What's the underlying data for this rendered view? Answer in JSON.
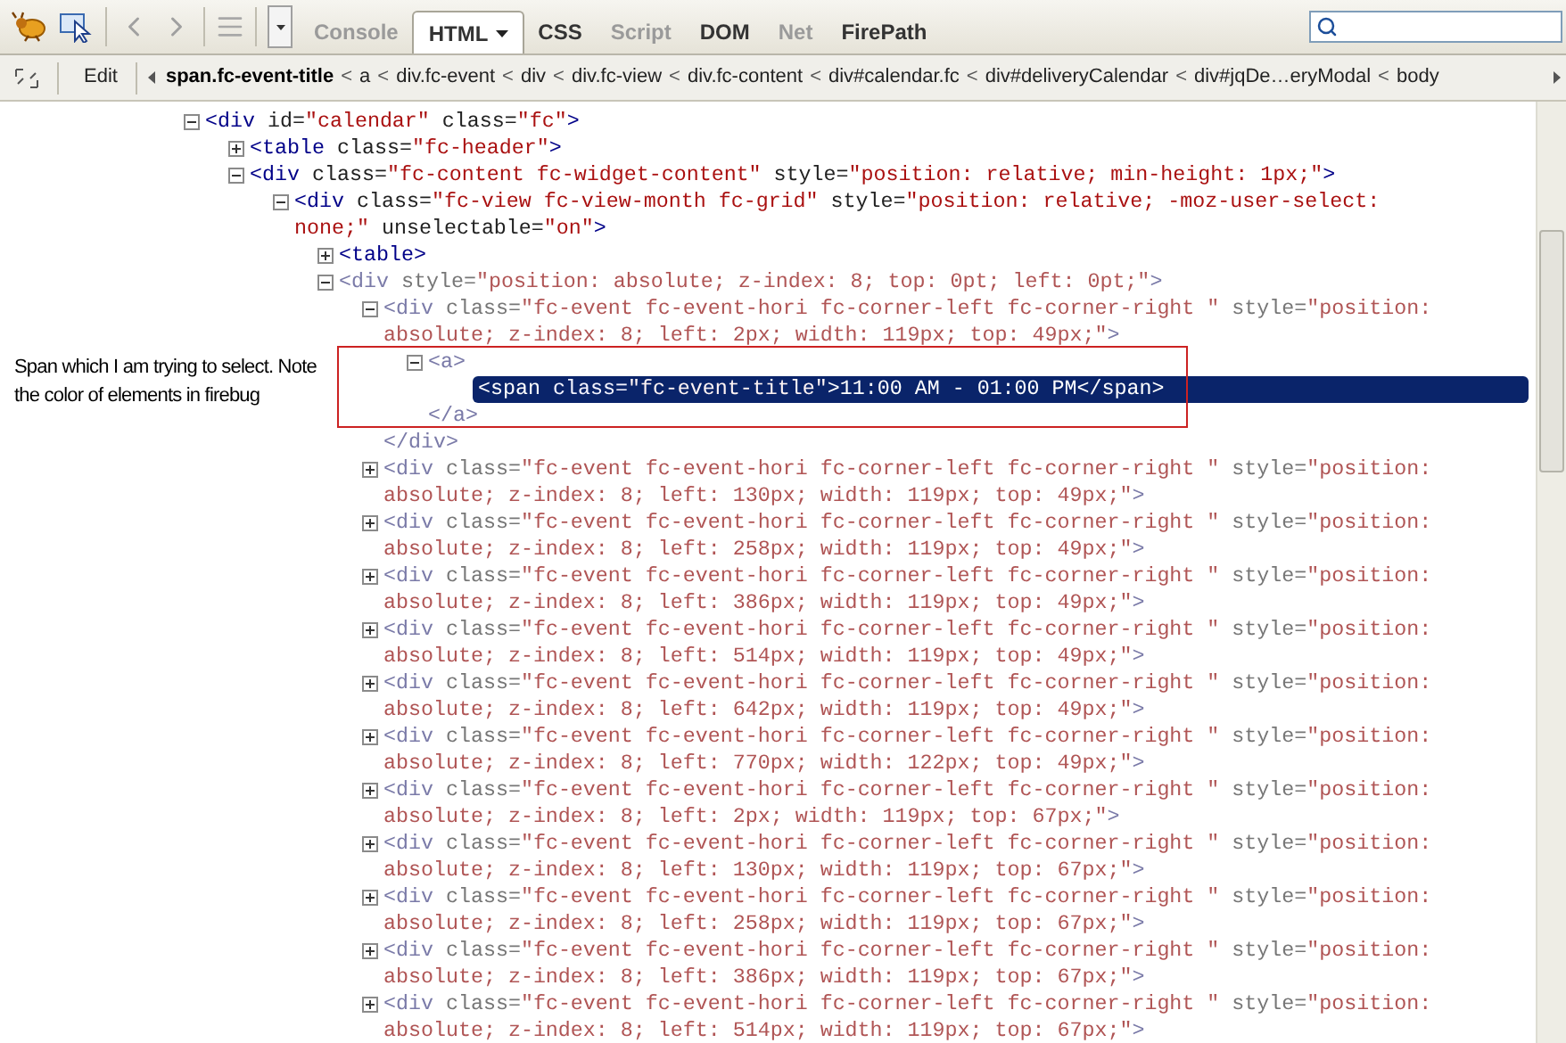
{
  "toolbar": {
    "tabs": [
      {
        "label": "Console",
        "selected": false,
        "disabled": true,
        "menu": false
      },
      {
        "label": "HTML",
        "selected": true,
        "disabled": false,
        "menu": true
      },
      {
        "label": "CSS",
        "selected": false,
        "disabled": false,
        "menu": false
      },
      {
        "label": "Script",
        "selected": false,
        "disabled": true,
        "menu": false
      },
      {
        "label": "DOM",
        "selected": false,
        "disabled": false,
        "menu": false
      },
      {
        "label": "Net",
        "selected": false,
        "disabled": true,
        "menu": false
      },
      {
        "label": "FirePath",
        "selected": false,
        "disabled": false,
        "menu": false
      }
    ]
  },
  "breadcrumb": {
    "edit_button": "Edit",
    "items": [
      {
        "kind": "crumb",
        "label": "span.fc-event-title",
        "selected": true
      },
      {
        "kind": "separator",
        "label": "<"
      },
      {
        "kind": "crumb",
        "label": "a",
        "selected": false
      },
      {
        "kind": "separator",
        "label": "<"
      },
      {
        "kind": "crumb",
        "label": "div.fc-event",
        "selected": false
      },
      {
        "kind": "separator",
        "label": "<"
      },
      {
        "kind": "crumb",
        "label": "div",
        "selected": false
      },
      {
        "kind": "separator",
        "label": "<"
      },
      {
        "kind": "crumb",
        "label": "div.fc-view",
        "selected": false
      },
      {
        "kind": "separator",
        "label": "<"
      },
      {
        "kind": "crumb",
        "label": "div.fc-content",
        "selected": false
      },
      {
        "kind": "separator",
        "label": "<"
      },
      {
        "kind": "crumb",
        "label": "div#calendar.fc",
        "selected": false
      },
      {
        "kind": "separator",
        "label": "<"
      },
      {
        "kind": "crumb",
        "label": "div#deliveryCalendar",
        "selected": false
      },
      {
        "kind": "separator",
        "label": "<"
      },
      {
        "kind": "crumb",
        "label": "div#jqDe…eryModal",
        "selected": false
      },
      {
        "kind": "separator",
        "label": "<"
      },
      {
        "kind": "crumb",
        "label": "body",
        "selected": false
      }
    ]
  },
  "tree": [
    {
      "expanded": true,
      "faded": false,
      "selected": false,
      "parts": [
        {
          "kind": "tag",
          "text": "<div"
        },
        {
          "kind": "attr",
          "text": " id="
        },
        {
          "kind": "value",
          "text": "\"calendar\""
        },
        {
          "kind": "attr",
          "text": " class="
        },
        {
          "kind": "value",
          "text": "\"fc\""
        },
        {
          "kind": "tag",
          "text": ">"
        }
      ],
      "children": [
        {
          "expanded": false,
          "faded": false,
          "selected": false,
          "parts": [
            {
              "kind": "tag",
              "text": "<table"
            },
            {
              "kind": "attr",
              "text": " class="
            },
            {
              "kind": "value",
              "text": "\"fc-header\""
            },
            {
              "kind": "tag",
              "text": ">"
            }
          ]
        },
        {
          "expanded": true,
          "faded": false,
          "selected": false,
          "parts": [
            {
              "kind": "tag",
              "text": "<div"
            },
            {
              "kind": "attr",
              "text": " class="
            },
            {
              "kind": "value",
              "text": "\"fc-content fc-widget-content\""
            },
            {
              "kind": "attr",
              "text": " style="
            },
            {
              "kind": "value",
              "text": "\"position: relative; min-height: 1px;\""
            },
            {
              "kind": "tag",
              "text": ">"
            }
          ],
          "children": [
            {
              "expanded": true,
              "faded": false,
              "selected": false,
              "parts": [
                {
                  "kind": "tag",
                  "text": "<div"
                },
                {
                  "kind": "attr",
                  "text": " class="
                },
                {
                  "kind": "value",
                  "text": "\"fc-view fc-view-month fc-grid\""
                },
                {
                  "kind": "attr",
                  "text": " style="
                },
                {
                  "kind": "value",
                  "text": "\"position: relative; -moz-user-select: none;\""
                },
                {
                  "kind": "attr",
                  "text": " unselectable="
                },
                {
                  "kind": "value",
                  "text": "\"on\""
                },
                {
                  "kind": "tag",
                  "text": ">"
                }
              ],
              "children": [
                {
                  "expanded": false,
                  "faded": false,
                  "selected": false,
                  "parts": [
                    {
                      "kind": "tag",
                      "text": "<table"
                    },
                    {
                      "kind": "tag",
                      "text": ">"
                    }
                  ]
                },
                {
                  "expanded": true,
                  "faded": true,
                  "selected": false,
                  "parts": [
                    {
                      "kind": "tag",
                      "text": "<div"
                    },
                    {
                      "kind": "attr",
                      "text": " style="
                    },
                    {
                      "kind": "value",
                      "text": "\"position: absolute; z-index: 8; top: 0pt; left: 0pt;\""
                    },
                    {
                      "kind": "tag",
                      "text": ">"
                    }
                  ],
                  "children": [
                    {
                      "expanded": true,
                      "faded": true,
                      "selected": false,
                      "parts": [
                        {
                          "kind": "tag",
                          "text": "<div"
                        },
                        {
                          "kind": "attr",
                          "text": " class="
                        },
                        {
                          "kind": "value",
                          "text": "\"fc-event fc-event-hori fc-corner-left fc-corner-right \""
                        },
                        {
                          "kind": "attr",
                          "text": " style="
                        },
                        {
                          "kind": "value",
                          "text": "\"position: absolute; z-index: 8; left: 2px; width: 119px; top: 49px;\""
                        },
                        {
                          "kind": "tag",
                          "text": ">"
                        }
                      ],
                      "closing": "</div>",
                      "children": [
                        {
                          "expanded": true,
                          "faded": true,
                          "selected": false,
                          "parts": [
                            {
                              "kind": "tag",
                              "text": "<a"
                            },
                            {
                              "kind": "tag",
                              "text": ">"
                            }
                          ],
                          "closing": "</a>",
                          "children": [
                            {
                              "selected": true,
                              "parts": [
                                {
                                  "kind": "tag",
                                  "text": "<span"
                                },
                                {
                                  "kind": "attr",
                                  "text": " class="
                                },
                                {
                                  "kind": "value",
                                  "text": "\"fc-event-title\""
                                },
                                {
                                  "kind": "tag",
                                  "text": ">"
                                },
                                {
                                  "kind": "text",
                                  "text": "11:00 AM - 01:00 PM"
                                },
                                {
                                  "kind": "tag",
                                  "text": "</span>"
                                }
                              ]
                            }
                          ]
                        }
                      ]
                    },
                    {
                      "expanded": false,
                      "faded": true,
                      "selected": false,
                      "parts": [
                        {
                          "kind": "tag",
                          "text": "<div"
                        },
                        {
                          "kind": "attr",
                          "text": " class="
                        },
                        {
                          "kind": "value",
                          "text": "\"fc-event fc-event-hori fc-corner-left fc-corner-right \""
                        },
                        {
                          "kind": "attr",
                          "text": " style="
                        },
                        {
                          "kind": "value",
                          "text": "\"position: absolute; z-index: 8; left: 130px; width: 119px; top: 49px;\""
                        },
                        {
                          "kind": "tag",
                          "text": ">"
                        }
                      ]
                    },
                    {
                      "expanded": false,
                      "faded": true,
                      "selected": false,
                      "parts": [
                        {
                          "kind": "tag",
                          "text": "<div"
                        },
                        {
                          "kind": "attr",
                          "text": " class="
                        },
                        {
                          "kind": "value",
                          "text": "\"fc-event fc-event-hori fc-corner-left fc-corner-right \""
                        },
                        {
                          "kind": "attr",
                          "text": " style="
                        },
                        {
                          "kind": "value",
                          "text": "\"position: absolute; z-index: 8; left: 258px; width: 119px; top: 49px;\""
                        },
                        {
                          "kind": "tag",
                          "text": ">"
                        }
                      ]
                    },
                    {
                      "expanded": false,
                      "faded": true,
                      "selected": false,
                      "parts": [
                        {
                          "kind": "tag",
                          "text": "<div"
                        },
                        {
                          "kind": "attr",
                          "text": " class="
                        },
                        {
                          "kind": "value",
                          "text": "\"fc-event fc-event-hori fc-corner-left fc-corner-right \""
                        },
                        {
                          "kind": "attr",
                          "text": " style="
                        },
                        {
                          "kind": "value",
                          "text": "\"position: absolute; z-index: 8; left: 386px; width: 119px; top: 49px;\""
                        },
                        {
                          "kind": "tag",
                          "text": ">"
                        }
                      ]
                    },
                    {
                      "expanded": false,
                      "faded": true,
                      "selected": false,
                      "parts": [
                        {
                          "kind": "tag",
                          "text": "<div"
                        },
                        {
                          "kind": "attr",
                          "text": " class="
                        },
                        {
                          "kind": "value",
                          "text": "\"fc-event fc-event-hori fc-corner-left fc-corner-right \""
                        },
                        {
                          "kind": "attr",
                          "text": " style="
                        },
                        {
                          "kind": "value",
                          "text": "\"position: absolute; z-index: 8; left: 514px; width: 119px; top: 49px;\""
                        },
                        {
                          "kind": "tag",
                          "text": ">"
                        }
                      ]
                    },
                    {
                      "expanded": false,
                      "faded": true,
                      "selected": false,
                      "parts": [
                        {
                          "kind": "tag",
                          "text": "<div"
                        },
                        {
                          "kind": "attr",
                          "text": " class="
                        },
                        {
                          "kind": "value",
                          "text": "\"fc-event fc-event-hori fc-corner-left fc-corner-right \""
                        },
                        {
                          "kind": "attr",
                          "text": " style="
                        },
                        {
                          "kind": "value",
                          "text": "\"position: absolute; z-index: 8; left: 642px; width: 119px; top: 49px;\""
                        },
                        {
                          "kind": "tag",
                          "text": ">"
                        }
                      ]
                    },
                    {
                      "expanded": false,
                      "faded": true,
                      "selected": false,
                      "parts": [
                        {
                          "kind": "tag",
                          "text": "<div"
                        },
                        {
                          "kind": "attr",
                          "text": " class="
                        },
                        {
                          "kind": "value",
                          "text": "\"fc-event fc-event-hori fc-corner-left fc-corner-right \""
                        },
                        {
                          "kind": "attr",
                          "text": " style="
                        },
                        {
                          "kind": "value",
                          "text": "\"position: absolute; z-index: 8; left: 770px; width: 122px; top: 49px;\""
                        },
                        {
                          "kind": "tag",
                          "text": ">"
                        }
                      ]
                    },
                    {
                      "expanded": false,
                      "faded": true,
                      "selected": false,
                      "parts": [
                        {
                          "kind": "tag",
                          "text": "<div"
                        },
                        {
                          "kind": "attr",
                          "text": " class="
                        },
                        {
                          "kind": "value",
                          "text": "\"fc-event fc-event-hori fc-corner-left fc-corner-right \""
                        },
                        {
                          "kind": "attr",
                          "text": " style="
                        },
                        {
                          "kind": "value",
                          "text": "\"position: absolute; z-index: 8; left: 2px; width: 119px; top: 67px;\""
                        },
                        {
                          "kind": "tag",
                          "text": ">"
                        }
                      ]
                    },
                    {
                      "expanded": false,
                      "faded": true,
                      "selected": false,
                      "parts": [
                        {
                          "kind": "tag",
                          "text": "<div"
                        },
                        {
                          "kind": "attr",
                          "text": " class="
                        },
                        {
                          "kind": "value",
                          "text": "\"fc-event fc-event-hori fc-corner-left fc-corner-right \""
                        },
                        {
                          "kind": "attr",
                          "text": " style="
                        },
                        {
                          "kind": "value",
                          "text": "\"position: absolute; z-index: 8; left: 130px; width: 119px; top: 67px;\""
                        },
                        {
                          "kind": "tag",
                          "text": ">"
                        }
                      ]
                    },
                    {
                      "expanded": false,
                      "faded": true,
                      "selected": false,
                      "parts": [
                        {
                          "kind": "tag",
                          "text": "<div"
                        },
                        {
                          "kind": "attr",
                          "text": " class="
                        },
                        {
                          "kind": "value",
                          "text": "\"fc-event fc-event-hori fc-corner-left fc-corner-right \""
                        },
                        {
                          "kind": "attr",
                          "text": " style="
                        },
                        {
                          "kind": "value",
                          "text": "\"position: absolute; z-index: 8; left: 258px; width: 119px; top: 67px;\""
                        },
                        {
                          "kind": "tag",
                          "text": ">"
                        }
                      ]
                    },
                    {
                      "expanded": false,
                      "faded": true,
                      "selected": false,
                      "parts": [
                        {
                          "kind": "tag",
                          "text": "<div"
                        },
                        {
                          "kind": "attr",
                          "text": " class="
                        },
                        {
                          "kind": "value",
                          "text": "\"fc-event fc-event-hori fc-corner-left fc-corner-right \""
                        },
                        {
                          "kind": "attr",
                          "text": " style="
                        },
                        {
                          "kind": "value",
                          "text": "\"position: absolute; z-index: 8; left: 386px; width: 119px; top: 67px;\""
                        },
                        {
                          "kind": "tag",
                          "text": ">"
                        }
                      ]
                    },
                    {
                      "expanded": false,
                      "faded": true,
                      "selected": false,
                      "parts": [
                        {
                          "kind": "tag",
                          "text": "<div"
                        },
                        {
                          "kind": "attr",
                          "text": " class="
                        },
                        {
                          "kind": "value",
                          "text": "\"fc-event fc-event-hori fc-corner-left fc-corner-right \""
                        },
                        {
                          "kind": "attr",
                          "text": " style="
                        },
                        {
                          "kind": "value",
                          "text": "\"position: absolute; z-index: 8; left: 514px; width: 119px; top: 67px;\""
                        },
                        {
                          "kind": "tag",
                          "text": ">"
                        }
                      ]
                    }
                  ]
                }
              ]
            }
          ]
        }
      ]
    }
  ],
  "annotation": "Span which I am trying to select. Note the color of elements in firebug"
}
